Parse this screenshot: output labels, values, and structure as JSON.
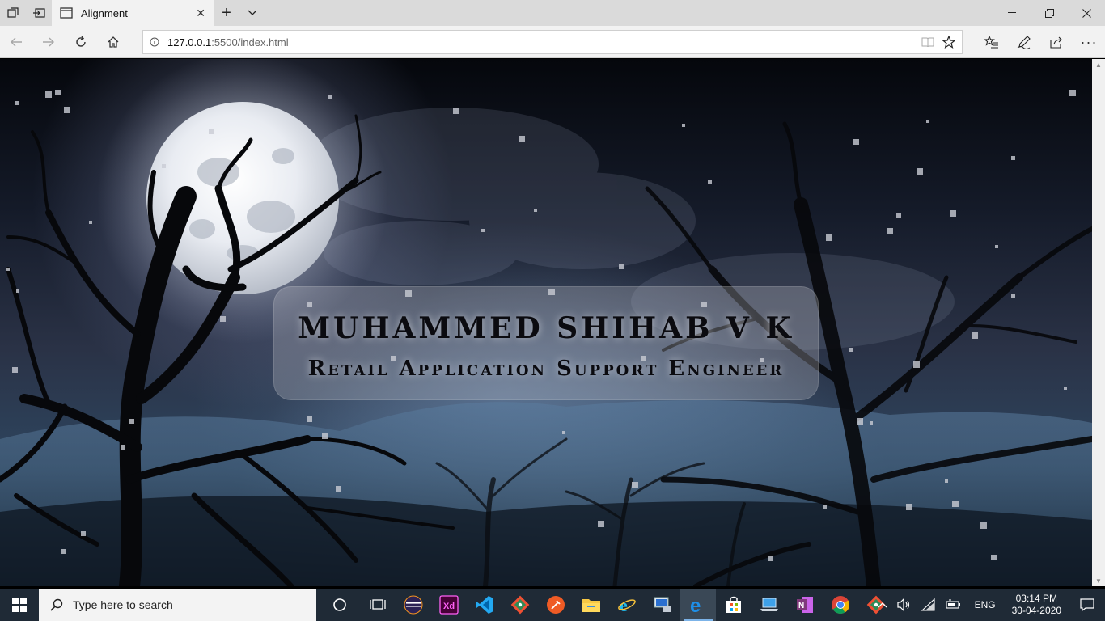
{
  "browser": {
    "tab_title": "Alignment",
    "address": {
      "host": "127.0.0.1",
      "path": ":5500/index.html"
    }
  },
  "page": {
    "name": "MUHAMMED SHIHAB V K",
    "title": "Retail Application Support Engineer"
  },
  "taskbar": {
    "search_placeholder": "Type here to search",
    "apps": [
      {
        "name": "task-view-icon"
      },
      {
        "name": "eclipse-icon"
      },
      {
        "name": "adobe-xd-icon"
      },
      {
        "name": "vscode-icon"
      },
      {
        "name": "git-icon"
      },
      {
        "name": "postman-icon"
      },
      {
        "name": "file-explorer-icon"
      },
      {
        "name": "internet-explorer-icon"
      },
      {
        "name": "remote-desktop-icon"
      },
      {
        "name": "edge-icon"
      },
      {
        "name": "store-icon"
      },
      {
        "name": "laptop-icon"
      },
      {
        "name": "onenote-icon"
      },
      {
        "name": "chrome-icon"
      },
      {
        "name": "git-2-icon"
      }
    ],
    "language": "ENG",
    "time": "03:14 PM",
    "date": "30-04-2020"
  },
  "colors": {
    "accent": "#7cb3e8",
    "taskbar_bg": "#1f2a36",
    "chrome_bg": "#f2f2f2",
    "onenote": "#80397b",
    "xd": "#470137"
  }
}
